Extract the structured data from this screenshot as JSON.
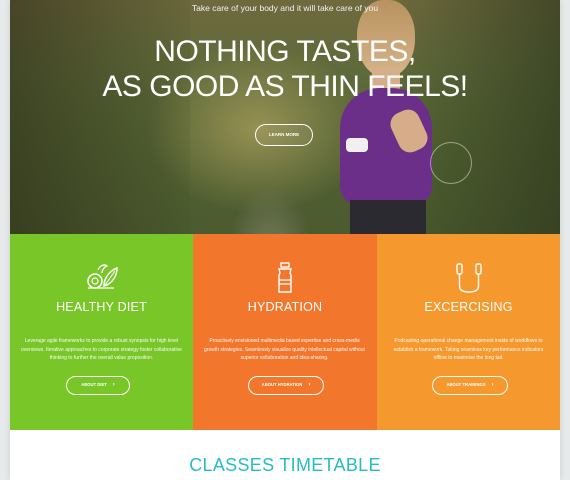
{
  "hero": {
    "tagline": "Take care of your body and it will take care of you",
    "headline_line1": "NOTHING TASTES,",
    "headline_line2": "AS GOOD AS THIN FEELS!",
    "button_label": "LEARN MORE"
  },
  "features": [
    {
      "title": "HEALTHY DIET",
      "description": "Leverage agile frameworks to provide a robust synopsis for high level overviews. Iterative approaches to corporate strategy foster collaborative thinking to further the overall value proposition.",
      "button_label": "ABOUT DIET",
      "icon": "vegetables-icon",
      "color": "#79c628"
    },
    {
      "title": "HYDRATION",
      "description": "Proactively envisioned multimedia based expertise and cross-media growth strategies. Seamlessly visualize quality intellectual capital without superior collaboration and idea-sharing.",
      "button_label": "ABOUT HYDRATION",
      "icon": "water-bottle-icon",
      "color": "#f2772d"
    },
    {
      "title": "EXCERCISING",
      "description": "Podcasting operational change management inside of workflows to establish a framework. Taking seamless key performance indicators offline to maximise the long tail.",
      "button_label": "ABOUT TRAININGS",
      "icon": "jump-rope-icon",
      "color": "#f5992e"
    }
  ],
  "section": {
    "title": "CLASSES TIMETABLE",
    "color": "#27bcc6"
  },
  "chevron": "›"
}
